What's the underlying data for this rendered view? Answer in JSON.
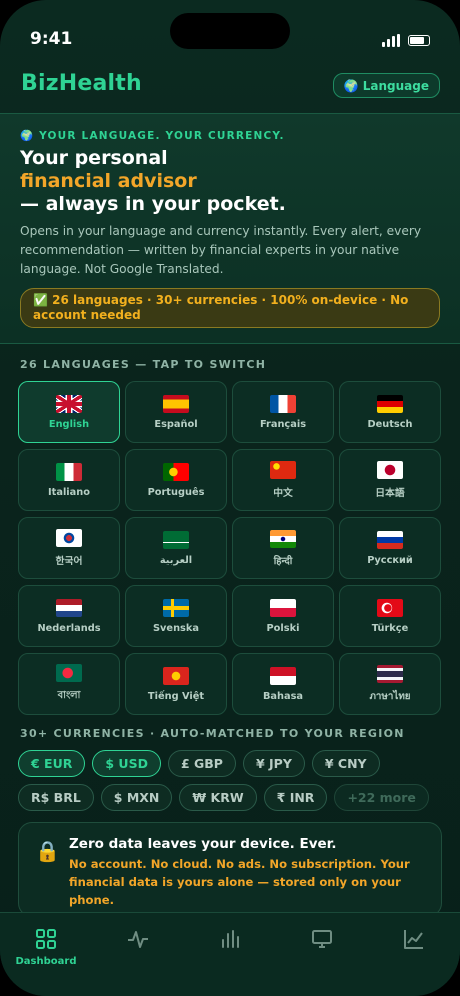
{
  "status": {
    "time": "9:41"
  },
  "header": {
    "brand": "BizHealth",
    "language_button": "🌍 Language"
  },
  "hero": {
    "kicker": "🌍 YOUR LANGUAGE. YOUR CURRENCY.",
    "title_line1": "Your personal",
    "title_accent": "financial advisor",
    "title_line3": "— always in your pocket.",
    "description": "Opens in your language and currency instantly. Every alert, every recommendation — written by financial experts in your native language. Not Google Translated.",
    "pill": "✅ 26 languages · 30+ currencies · 100% on-device · No account needed"
  },
  "languages": {
    "heading": "26 LANGUAGES — TAP TO SWITCH",
    "items": [
      {
        "label": "English",
        "flag": "uk"
      },
      {
        "label": "Español",
        "flag": "es"
      },
      {
        "label": "Français",
        "flag": "fr"
      },
      {
        "label": "Deutsch",
        "flag": "de"
      },
      {
        "label": "Italiano",
        "flag": "it"
      },
      {
        "label": "Português",
        "flag": "pt"
      },
      {
        "label": "中文",
        "flag": "cn"
      },
      {
        "label": "日本語",
        "flag": "jp"
      },
      {
        "label": "한국어",
        "flag": "kr"
      },
      {
        "label": "العربية",
        "flag": "sa"
      },
      {
        "label": "हिन्दी",
        "flag": "in"
      },
      {
        "label": "Русский",
        "flag": "ru"
      },
      {
        "label": "Nederlands",
        "flag": "nl"
      },
      {
        "label": "Svenska",
        "flag": "se"
      },
      {
        "label": "Polski",
        "flag": "pl"
      },
      {
        "label": "Türkçe",
        "flag": "tr"
      },
      {
        "label": "বাংলা",
        "flag": "bd"
      },
      {
        "label": "Tiếng Việt",
        "flag": "vn"
      },
      {
        "label": "Bahasa",
        "flag": "id"
      },
      {
        "label": "ภาษาไทย",
        "flag": "th"
      }
    ]
  },
  "currencies": {
    "heading": "30+ CURRENCIES · AUTO-MATCHED TO YOUR REGION",
    "row1": [
      "€ EUR",
      "$ USD",
      "£ GBP",
      "¥ JPY",
      "¥ CNY"
    ],
    "row2": [
      "R$ BRL",
      "$ MXN",
      "₩ KRW",
      "₹ INR",
      "+22 more"
    ]
  },
  "privacy": {
    "title": "Zero data leaves your device. Ever.",
    "text": "No account. No cloud. No ads. No subscription. Your financial data is yours alone — stored only on your phone."
  },
  "tabbar": {
    "dashboard": "Dashboard"
  },
  "colors": {
    "accent": "#2fd394",
    "amber": "#f2a629",
    "background": "#0a241c"
  }
}
